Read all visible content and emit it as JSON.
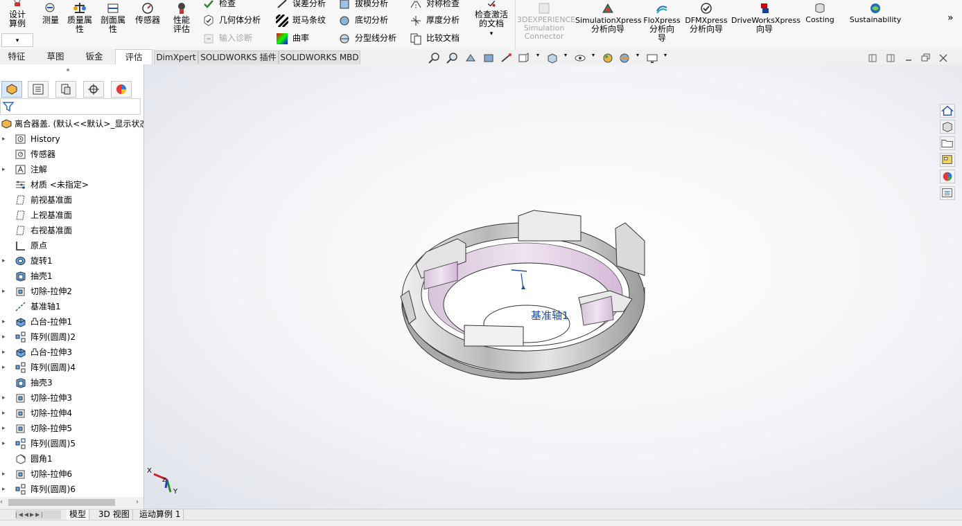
{
  "ribbon": {
    "design_study": "设计算例",
    "measure": "测量",
    "mass_props": "质量属性",
    "section_props": "剖面属性",
    "sensor": "传感器",
    "perf_eval": "性能评估",
    "check": "检查",
    "geom_analysis": "几何体分析",
    "import_diag": "输入诊断",
    "deviation": "误差分析",
    "zebra": "斑马条纹",
    "curvature": "曲率",
    "draft": "拔模分析",
    "undercut": "底切分析",
    "parting_line": "分型线分析",
    "symmetry": "对称检查",
    "thickness": "厚度分析",
    "compare": "比较文档",
    "check_active": "检查激活的文档",
    "sim_connector": [
      "3DEXPERIENCE",
      "Simulation",
      "Connector"
    ],
    "simxpress": [
      "SimulationXpress",
      "分析向导"
    ],
    "floxpress": [
      "FloXpress",
      "分析向",
      "导"
    ],
    "dfmxpress": [
      "DFMXpress",
      "分析向导"
    ],
    "driveworks": [
      "DriveWorksXpress",
      "向导"
    ],
    "costing": "Costing",
    "sustainability": "Sustainability",
    "more": "»"
  },
  "tabs": [
    "特征",
    "草图",
    "钣金",
    "评估"
  ],
  "addin_tabs": [
    "DimXpert",
    "SOLIDWORKS 插件",
    "SOLIDWORKS MBD"
  ],
  "tree": {
    "root": "离合器盖. (默认<<默认>_显示状态",
    "items": [
      {
        "label": "History",
        "arrow": true,
        "icon": "history-icon"
      },
      {
        "label": "传感器",
        "arrow": false,
        "icon": "sensor-icon"
      },
      {
        "label": "注解",
        "arrow": true,
        "icon": "annotation-icon"
      },
      {
        "label": "材质 <未指定>",
        "arrow": false,
        "icon": "material-icon"
      },
      {
        "label": "前视基准面",
        "arrow": false,
        "icon": "plane-icon"
      },
      {
        "label": "上视基准面",
        "arrow": false,
        "icon": "plane-icon"
      },
      {
        "label": "右视基准面",
        "arrow": false,
        "icon": "plane-icon"
      },
      {
        "label": "原点",
        "arrow": false,
        "icon": "origin-icon"
      },
      {
        "label": "旋转1",
        "arrow": true,
        "icon": "revolve-icon"
      },
      {
        "label": "抽壳1",
        "arrow": false,
        "icon": "shell-icon"
      },
      {
        "label": "切除-拉伸2",
        "arrow": true,
        "icon": "cut-extrude-icon"
      },
      {
        "label": "基准轴1",
        "arrow": false,
        "icon": "axis-icon"
      },
      {
        "label": "凸台-拉伸1",
        "arrow": true,
        "icon": "boss-extrude-icon"
      },
      {
        "label": "阵列(圆周)2",
        "arrow": true,
        "icon": "circular-pattern-icon"
      },
      {
        "label": "凸台-拉伸3",
        "arrow": true,
        "icon": "boss-extrude-icon"
      },
      {
        "label": "阵列(圆周)4",
        "arrow": true,
        "icon": "circular-pattern-icon"
      },
      {
        "label": "抽壳3",
        "arrow": false,
        "icon": "shell-icon"
      },
      {
        "label": "切除-拉伸3",
        "arrow": true,
        "icon": "cut-extrude-icon"
      },
      {
        "label": "切除-拉伸4",
        "arrow": true,
        "icon": "cut-extrude-icon"
      },
      {
        "label": "切除-拉伸5",
        "arrow": true,
        "icon": "cut-extrude-icon"
      },
      {
        "label": "阵列(圆周)5",
        "arrow": true,
        "icon": "circular-pattern-icon"
      },
      {
        "label": "圆角1",
        "arrow": false,
        "icon": "fillet-icon"
      },
      {
        "label": "切除-拉伸6",
        "arrow": true,
        "icon": "cut-extrude-icon"
      },
      {
        "label": "阵列(圆周)6",
        "arrow": true,
        "icon": "circular-pattern-icon"
      }
    ]
  },
  "viewport": {
    "axis_label": "基准轴1",
    "triad_x": "X",
    "triad_y": "Y",
    "triad_z": "Z"
  },
  "bottom_tabs": [
    "模型",
    "3D 视图",
    "运动算例 1"
  ],
  "colors": {
    "accent": "#1f4e9c",
    "inner_face": "#d6b9d9",
    "body": "#c9c9c9"
  }
}
